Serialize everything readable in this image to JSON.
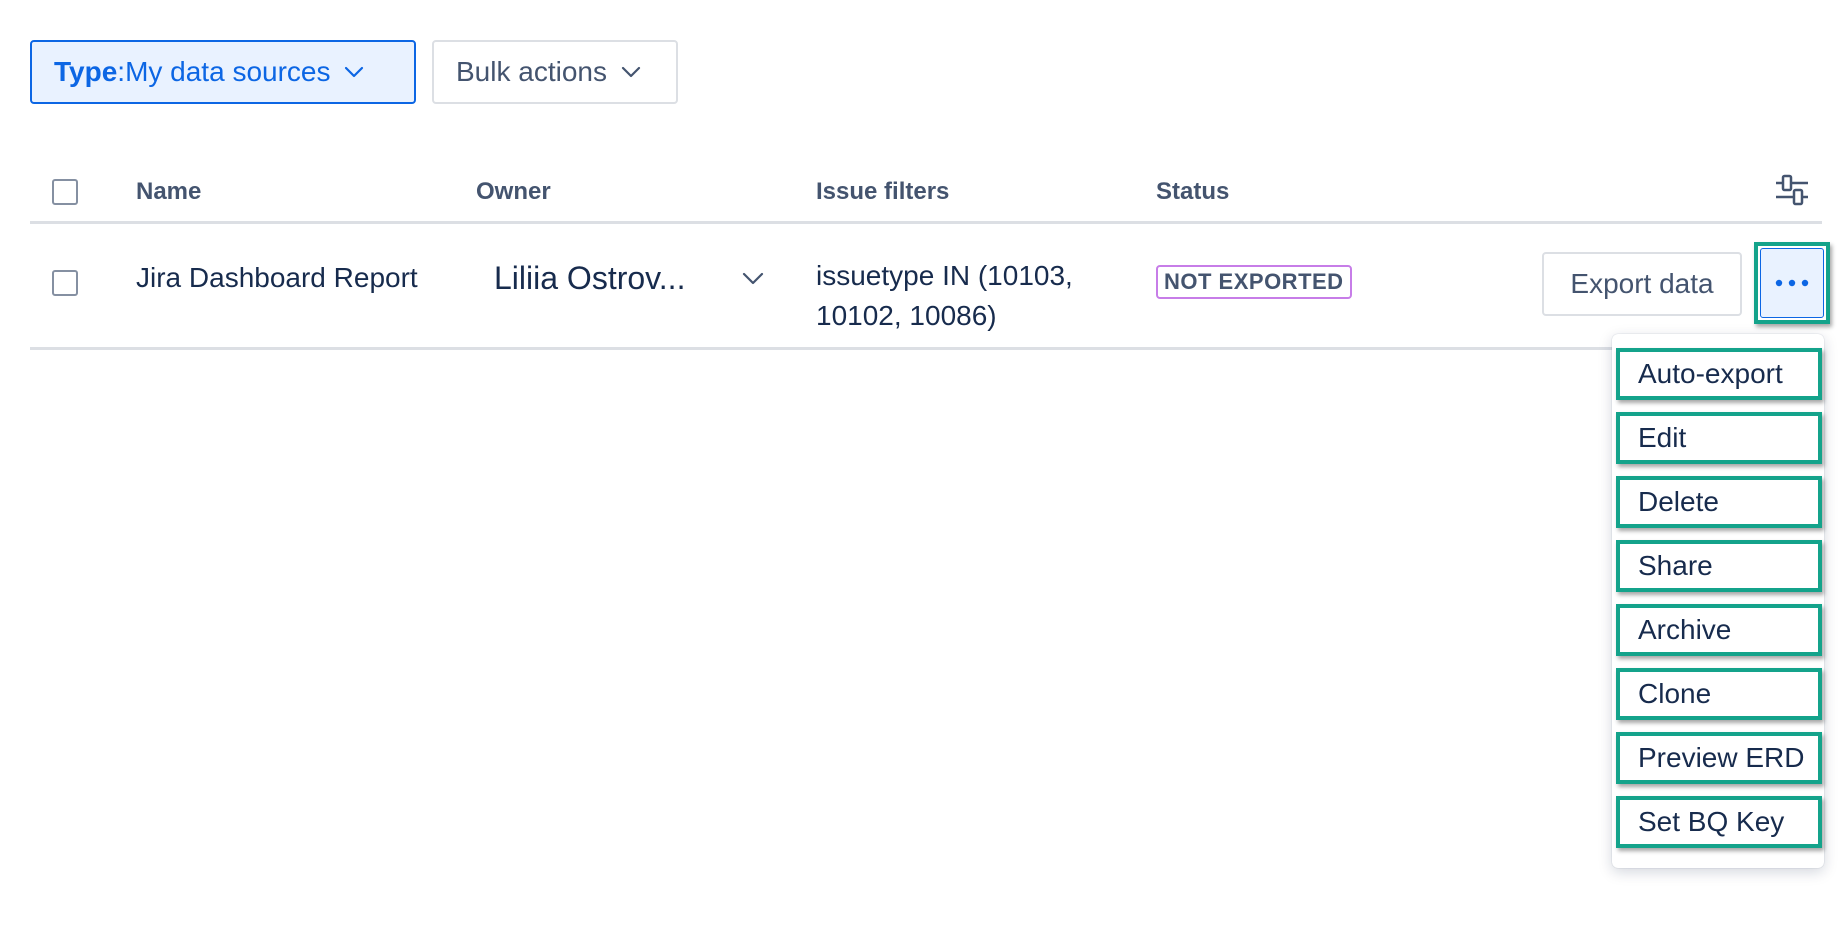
{
  "toolbar": {
    "type_filter": {
      "label_bold": "Type",
      "separator": ": ",
      "value": "My data sources",
      "icon": "chevron-down-icon"
    },
    "bulk_actions": {
      "label": "Bulk actions",
      "icon": "chevron-down-icon"
    }
  },
  "table": {
    "columns": [
      "Name",
      "Owner",
      "Issue filters",
      "Status"
    ],
    "settings_icon": "column-settings-icon",
    "rows": [
      {
        "name": "Jira Dashboard Report",
        "owner": "Liliia Ostrov...",
        "issue_filters_line1": "issuetype IN (10103,",
        "issue_filters_line2": "10102, 10086)",
        "status": "NOT EXPORTED",
        "export_label": "Export data",
        "more_icon": "more-icon"
      }
    ]
  },
  "menu": {
    "items": [
      "Auto-export",
      "Edit",
      "Delete",
      "Share",
      "Archive",
      "Clone",
      "Preview ERD",
      "Set BQ Key"
    ]
  },
  "colors": {
    "accent": "#0c66e4",
    "highlight": "#14a38b",
    "badge_border": "#c77de8"
  }
}
